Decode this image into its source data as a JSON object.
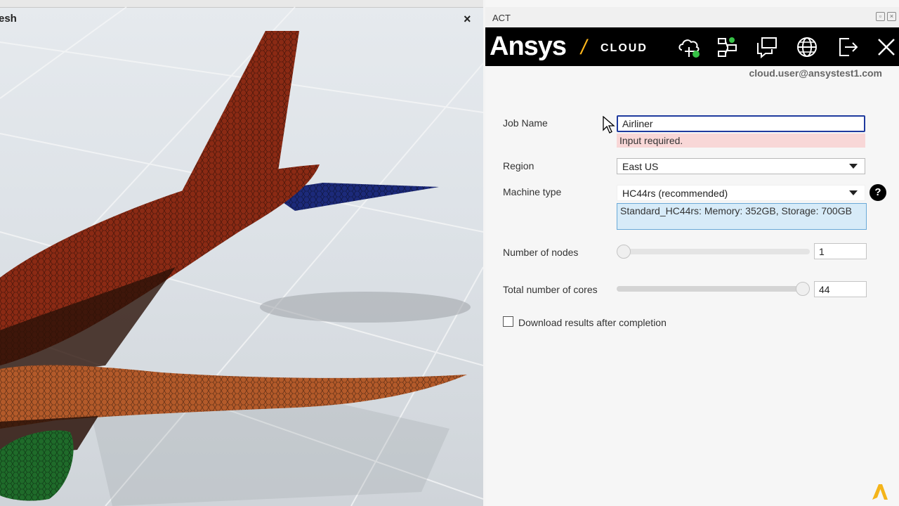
{
  "viewport": {
    "title": "esh",
    "close_glyph": "×"
  },
  "panel": {
    "title": "ACT",
    "brand": {
      "logo_text": "Ansys",
      "separator": "/",
      "product": "CLOUD",
      "accent_color": "#ffb71b"
    },
    "toolbar_icons": [
      "cloud-status-icon",
      "cluster-icon",
      "messages-icon",
      "globe-icon",
      "sign-out-icon",
      "close-icon"
    ],
    "user_email": "cloud.user@ansystest1.com",
    "form": {
      "job_name": {
        "label": "Job Name",
        "value": "Airliner",
        "error": "Input required."
      },
      "region": {
        "label": "Region",
        "value": "East US"
      },
      "machine_type": {
        "label": "Machine type",
        "value": "HC44rs (recommended)",
        "help": "?",
        "info": "Standard_HC44rs: Memory: 352GB, Storage: 700GB"
      },
      "nodes": {
        "label": "Number of nodes",
        "value": "1",
        "slider_fraction": 0.0
      },
      "cores": {
        "label": "Total number of cores",
        "value": "44",
        "slider_fraction": 1.0
      },
      "download": {
        "label": "Download results after completion",
        "checked": false
      }
    }
  },
  "colors": {
    "banner_bg": "#000000",
    "fuselage": "#8a2a14",
    "wing": "#b35a2a",
    "stabilizer": "#1c2a7a",
    "engine": "#1f6b2a",
    "error_bg": "#f8d7d7",
    "info_bg": "#d7ebf8"
  }
}
